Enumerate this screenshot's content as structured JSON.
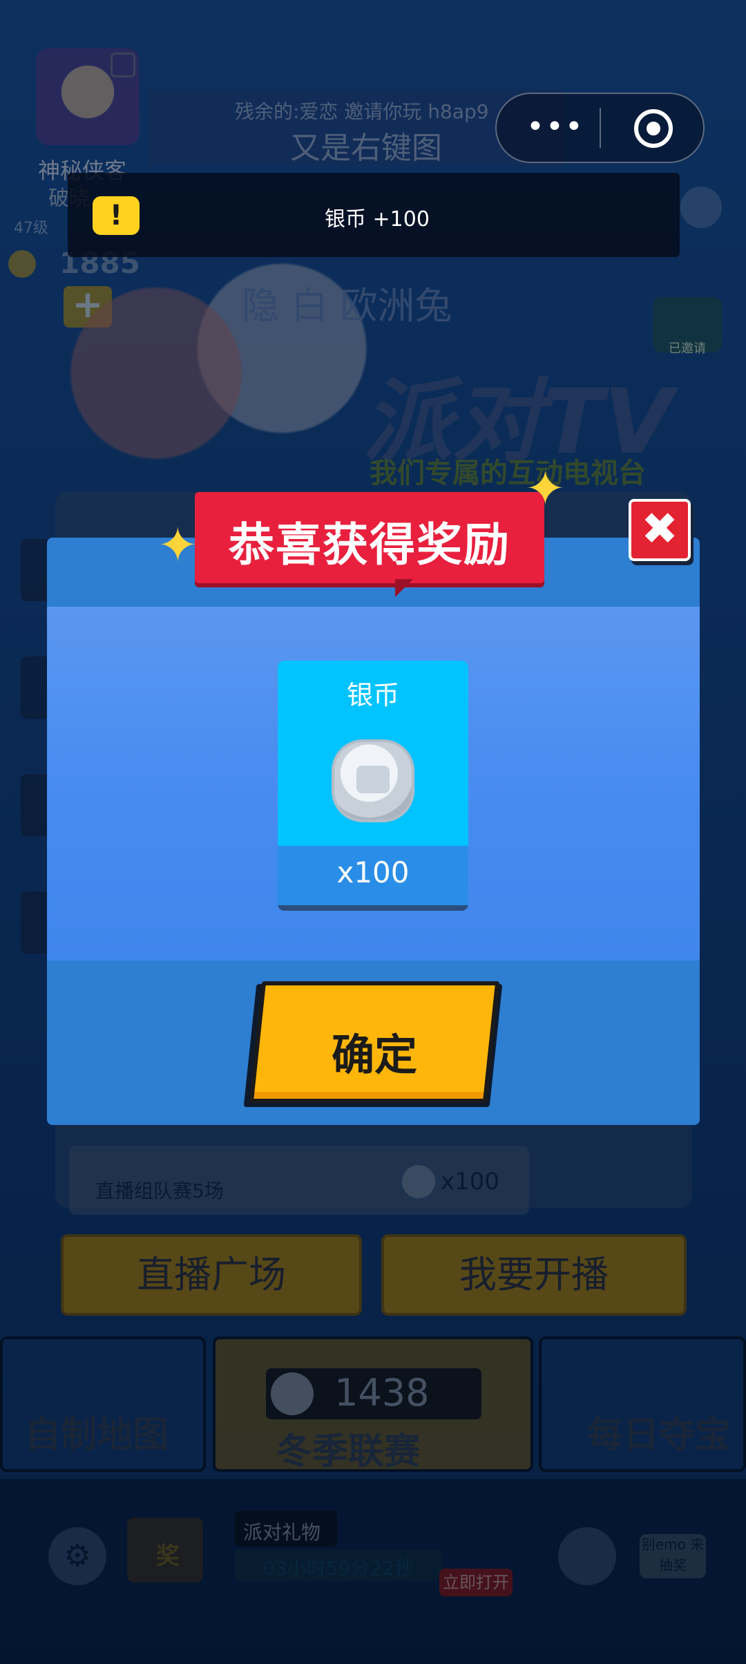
{
  "profile": {
    "nickname": "神秘侠客",
    "subtitle": "破晓",
    "level": "47级",
    "coins": "1885",
    "add": "+"
  },
  "room": {
    "subtitle": "残余的:爱恋 邀请你玩 h8ap9",
    "title": "又是右键图"
  },
  "capsule": {
    "dots": "•••"
  },
  "toast": {
    "icon": "!",
    "text": "银币 +100"
  },
  "stage": {
    "char_name": "隐 白 欧洲兔",
    "logo": "派对TV",
    "slogan": "我们专属的互动电视台",
    "badge": "已邀请"
  },
  "dialog": {
    "banner": "恭喜获得奖励",
    "close": "✖",
    "reward": {
      "name": "银币",
      "qty": "x100"
    },
    "confirm": "确定"
  },
  "task": {
    "label": "直播组队赛5场",
    "reward": "x100"
  },
  "actions": {
    "live_square": "直播广场",
    "go_live": "我要开播"
  },
  "tiles": {
    "custom_map": "自制地图",
    "winter_league": "冬季联赛",
    "daily_treasure": "每日夺宝"
  },
  "wallet": {
    "silver": "1438"
  },
  "bottom": {
    "gear": "⚙",
    "prize_label": "奖",
    "party_gift": "派对礼物",
    "timer": "03小时59分22秒",
    "open_now": "立即打开",
    "emo": "别emo 来抽奖"
  },
  "colors": {
    "banner": "#e8203e",
    "dialog": "#2e7ed2",
    "card": "#00c3ff",
    "confirm": "#ffb60a",
    "close": "#e32232"
  }
}
